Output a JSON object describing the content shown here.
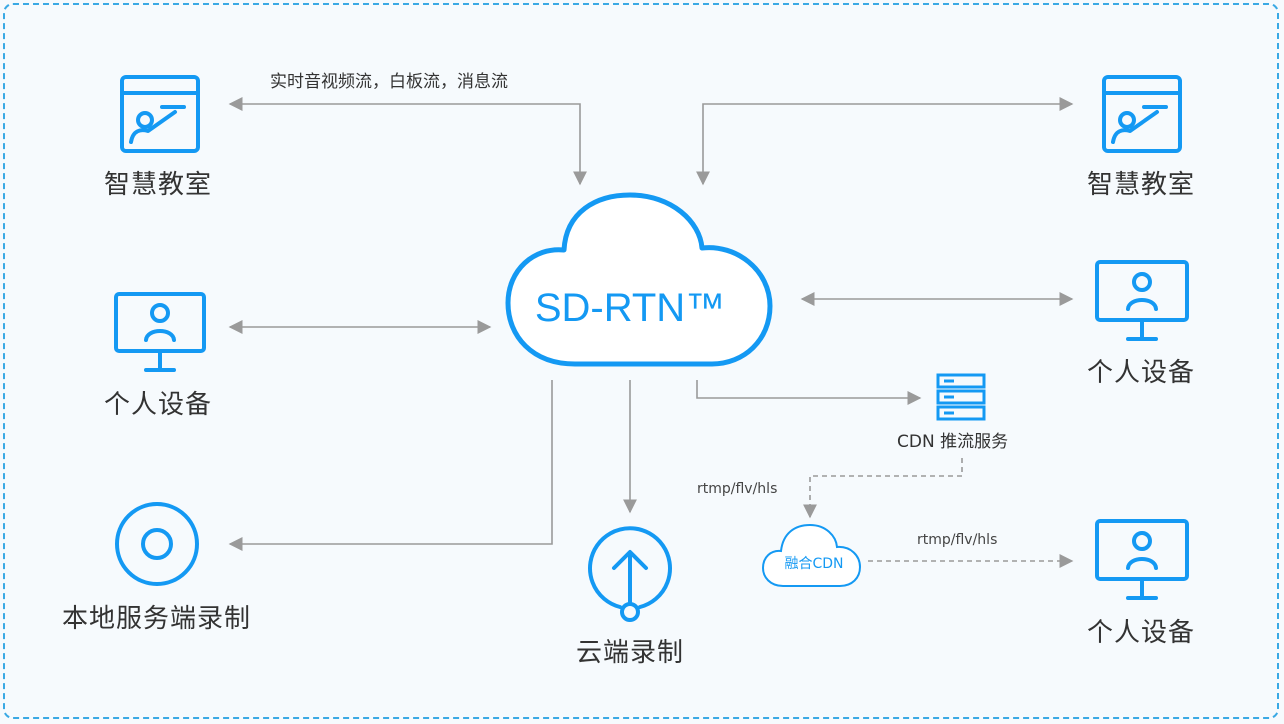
{
  "colors": {
    "accent": "#1499f3",
    "arrow": "#999999",
    "border": "#3aa9e4"
  },
  "core": {
    "label": "SD-RTN™"
  },
  "nodes": {
    "classroom_left": {
      "label": "智慧教室",
      "icon": "classroom-screen-icon"
    },
    "classroom_right": {
      "label": "智慧教室",
      "icon": "classroom-screen-icon"
    },
    "device_left": {
      "label": "个人设备",
      "icon": "monitor-user-icon"
    },
    "device_right": {
      "label": "个人设备",
      "icon": "monitor-user-icon"
    },
    "device_cdn": {
      "label": "个人设备",
      "icon": "monitor-user-icon"
    },
    "local_record": {
      "label": "本地服务端录制",
      "icon": "record-disc-icon"
    },
    "cloud_record": {
      "label": "云端录制",
      "icon": "upload-circle-icon"
    },
    "cdn_push": {
      "label": "CDN 推流服务",
      "icon": "server-stack-icon"
    },
    "fusion_cdn": {
      "label": "融合CDN",
      "icon": "small-cloud-icon"
    }
  },
  "edges": {
    "stream_types": "实时音视频流，白板流，消息流",
    "protocol_push": "rtmp/flv/hls",
    "protocol_play": "rtmp/flv/hls"
  }
}
